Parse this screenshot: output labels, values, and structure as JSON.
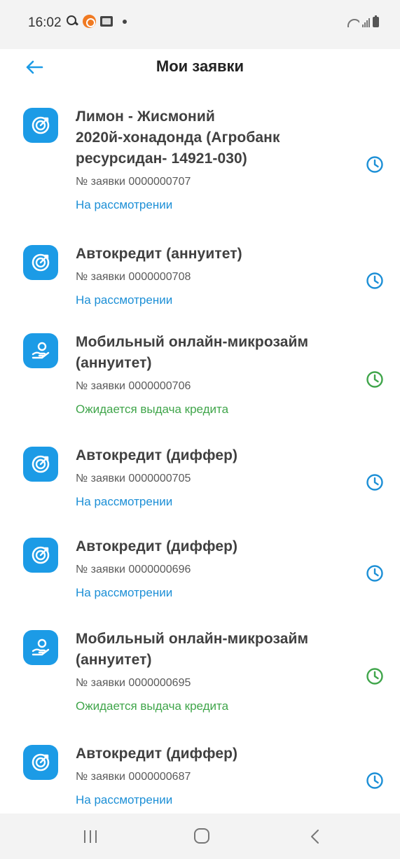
{
  "status_bar": {
    "time": "16:02",
    "icons": [
      "search-icon",
      "app-notification-icon",
      "gallery-icon",
      "dot-icon",
      "wifi-icon",
      "signal-icon",
      "battery-icon"
    ]
  },
  "header": {
    "title": "Мои заявки",
    "back_icon": "arrow-left-icon"
  },
  "colors": {
    "accent": "#1c9be6",
    "status_review": "#1c8fd6",
    "status_waiting": "#3fa54a"
  },
  "applications": [
    {
      "icon": "target-icon",
      "title_lines": [
        "Лимон - Жисмоний",
        "2020й-хонадонда (Агробанк",
        "ресурсидан- 14921-030)"
      ],
      "number": "№ заявки 0000000707",
      "status": "На рассмотрении",
      "status_type": "review"
    },
    {
      "icon": "target-icon",
      "title_lines": [
        "Автокредит (аннуитет)"
      ],
      "number": "№ заявки 0000000708",
      "status": "На рассмотрении",
      "status_type": "review"
    },
    {
      "icon": "hand-coin-icon",
      "title_lines": [
        "Мобильный онлайн-микрозайм",
        "(аннуитет)"
      ],
      "number": "№ заявки 0000000706",
      "status": "Ожидается выдача кредита",
      "status_type": "waiting"
    },
    {
      "icon": "target-icon",
      "title_lines": [
        "Автокредит (диффер)"
      ],
      "number": "№ заявки 0000000705",
      "status": "На рассмотрении",
      "status_type": "review"
    },
    {
      "icon": "target-icon",
      "title_lines": [
        "Автокредит (диффер)"
      ],
      "number": "№ заявки 0000000696",
      "status": "На рассмотрении",
      "status_type": "review"
    },
    {
      "icon": "hand-coin-icon",
      "title_lines": [
        "Мобильный онлайн-микрозайм",
        "(аннуитет)"
      ],
      "number": "№ заявки 0000000695",
      "status": "Ожидается выдача кредита",
      "status_type": "waiting"
    },
    {
      "icon": "target-icon",
      "title_lines": [
        "Автокредит (диффер)"
      ],
      "number": "№ заявки 0000000687",
      "status": "На рассмотрении",
      "status_type": "review"
    }
  ],
  "nav_bar": {
    "icons": [
      "recent-apps-icon",
      "home-icon",
      "back-icon"
    ]
  }
}
